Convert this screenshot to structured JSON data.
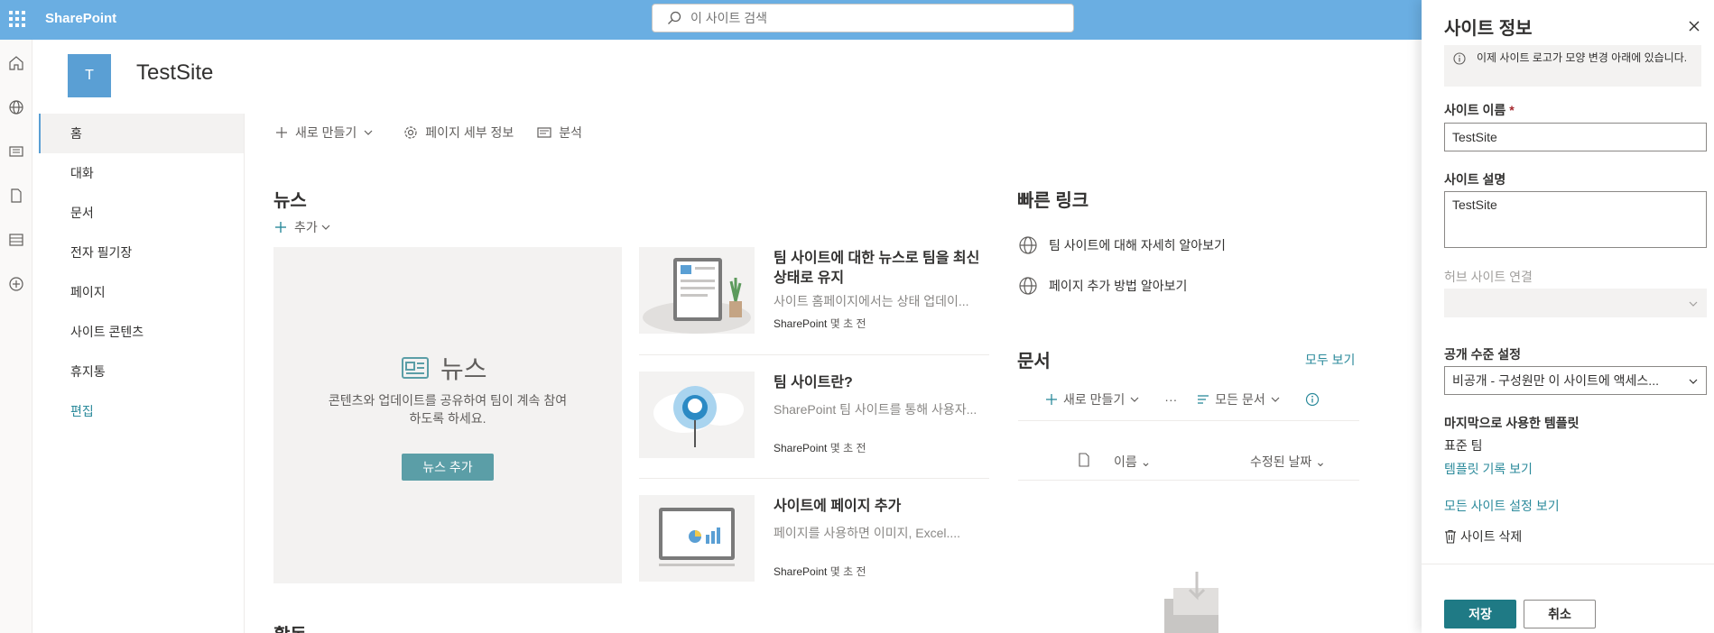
{
  "suitebar": {
    "brand": "SharePoint",
    "search_placeholder": "이 사이트 검색",
    "color": "#6aaee2"
  },
  "site": {
    "logo_letter": "T",
    "title": "TestSite"
  },
  "leftnav": {
    "items": [
      {
        "label": "홈"
      },
      {
        "label": "대화"
      },
      {
        "label": "문서"
      },
      {
        "label": "전자 필기장"
      },
      {
        "label": "페이지"
      },
      {
        "label": "사이트 콘텐츠"
      },
      {
        "label": "휴지통"
      },
      {
        "label": "편집"
      }
    ]
  },
  "commandbar": {
    "new_label": "새로 만들기",
    "page_details_label": "페이지 세부 정보",
    "analytics_label": "분석"
  },
  "news": {
    "heading": "뉴스",
    "add_label": "추가",
    "placeholder_title": "뉴스",
    "placeholder_desc": "콘텐츠와 업데이트를 공유하여 팀이 계속 참여하도록 하세요.",
    "add_news_button": "뉴스 추가",
    "items": [
      {
        "title": "팀 사이트에 대한 뉴스로 팀을 최신 상태로 유지",
        "desc": "사이트 홈페이지에서는 상태 업데이...",
        "source": "SharePoint",
        "time": "몇 초 전"
      },
      {
        "title": "팀 사이트란?",
        "desc": "SharePoint 팀 사이트를 통해 사용자...",
        "source": "SharePoint",
        "time": "몇 초 전"
      },
      {
        "title": "사이트에 페이지 추가",
        "desc": "페이지를 사용하면 이미지, Excel....",
        "source": "SharePoint",
        "time": "몇 초 전"
      }
    ]
  },
  "activity": {
    "heading": "활동"
  },
  "quicklinks": {
    "heading": "빠른 링크",
    "items": [
      {
        "label": "팀 사이트에 대해 자세히 알아보기"
      },
      {
        "label": "페이지 추가 방법 알아보기"
      }
    ]
  },
  "documents": {
    "heading": "문서",
    "see_all": "모두 보기",
    "new_label": "새로 만들기",
    "more_label": "···",
    "view_label": "모든 문서",
    "col_name": "이름",
    "col_modified": "수정된 날짜"
  },
  "panel": {
    "title": "사이트 정보",
    "info": "이제 사이트 로고가 모양 변경 아래에 있습니다.",
    "site_name_label": "사이트 이름",
    "required_mark": "*",
    "site_name_value": "TestSite",
    "site_desc_label": "사이트 설명",
    "site_desc_value": "TestSite",
    "hub_label": "허브 사이트 연결",
    "hub_value": "",
    "privacy_label": "공개 수준 설정",
    "privacy_value": "비공개 - 구성원만 이 사이트에 액세스...",
    "template_label": "마지막으로 사용한 템플릿",
    "template_value": "표준 팀",
    "template_history_link": "템플릿 기록 보기",
    "all_settings_link": "모든 사이트 설정 보기",
    "delete_label": "사이트 삭제",
    "save_button": "저장",
    "cancel_button": "취소",
    "accent": "#1f7a85"
  }
}
